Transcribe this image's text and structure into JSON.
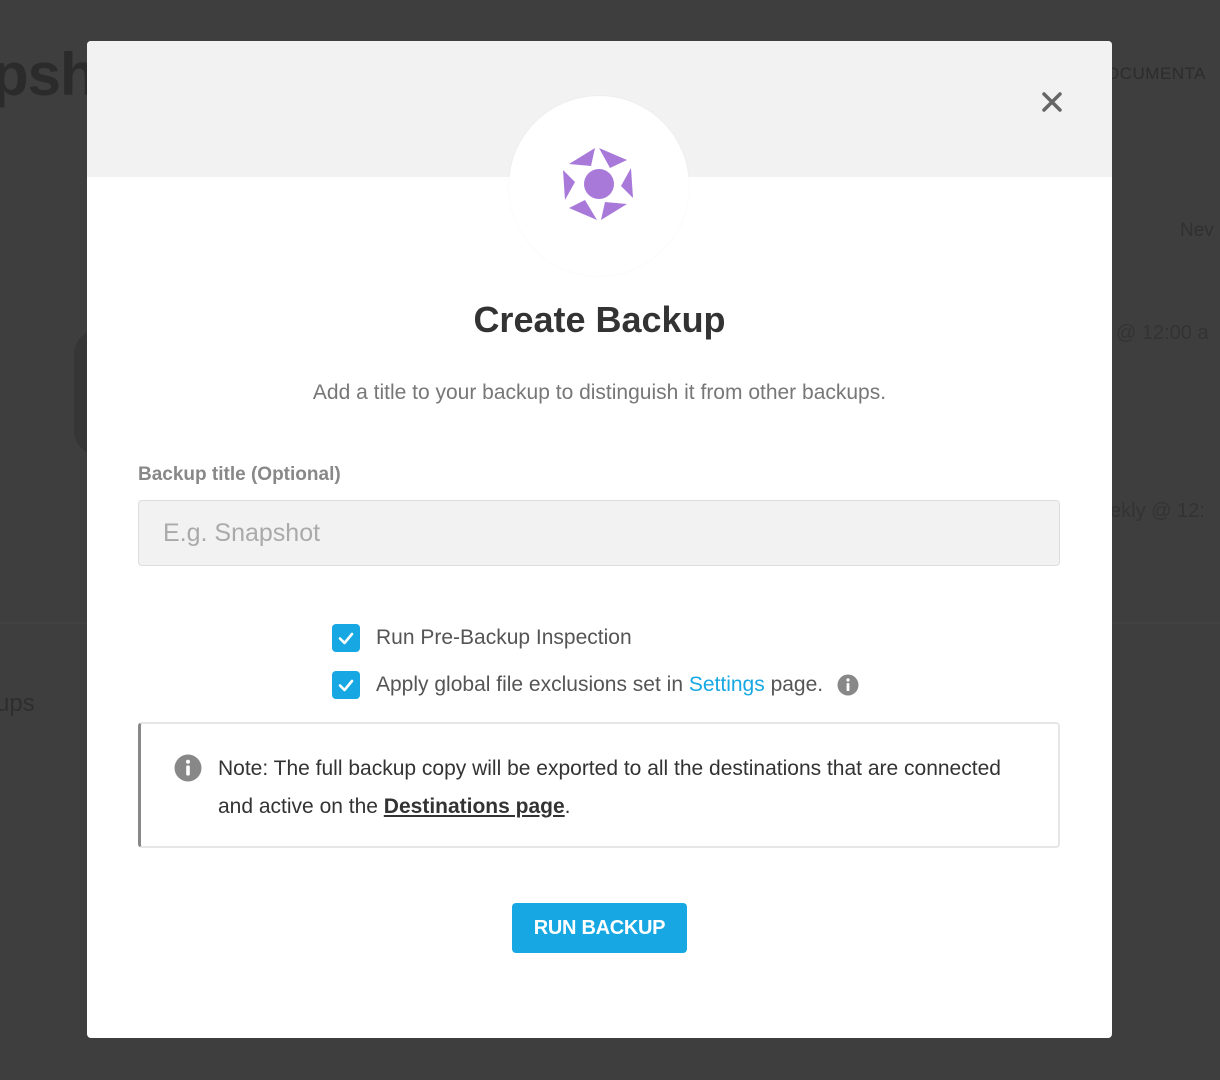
{
  "background": {
    "title_fragment": "psh",
    "documentation_fragment": "OCUMENTA",
    "nev_fragment": "Nev",
    "schedule_1": "l @ 12:00 a",
    "schedule_2": "ekly @ 12:",
    "ups_fragment": "ups"
  },
  "modal": {
    "close_symbol": "close-icon",
    "logo_icon": "snapshot-logo-icon",
    "title": "Create Backup",
    "subtitle": "Add a title to your backup to distinguish it from other backups.",
    "field_label": "Backup title (Optional)",
    "input_value": "",
    "input_placeholder": "E.g. Snapshot",
    "options": [
      {
        "label": "Run Pre-Backup Inspection",
        "checked": true
      },
      {
        "label_before": "Apply global file exclusions set in ",
        "link_text": "Settings",
        "label_after": " page.",
        "checked": true
      }
    ],
    "note": {
      "text_before": "Note: The full backup copy will be exported to all the destinations that are connected and active on the ",
      "link_text": "Destinations page",
      "text_after": "."
    },
    "run_button_label": "RUN BACKUP"
  },
  "colors": {
    "accent": "#17a8e3",
    "logo": "#a879d9",
    "overlay": "#3e3e3e",
    "header_band": "#f2f2f2"
  }
}
